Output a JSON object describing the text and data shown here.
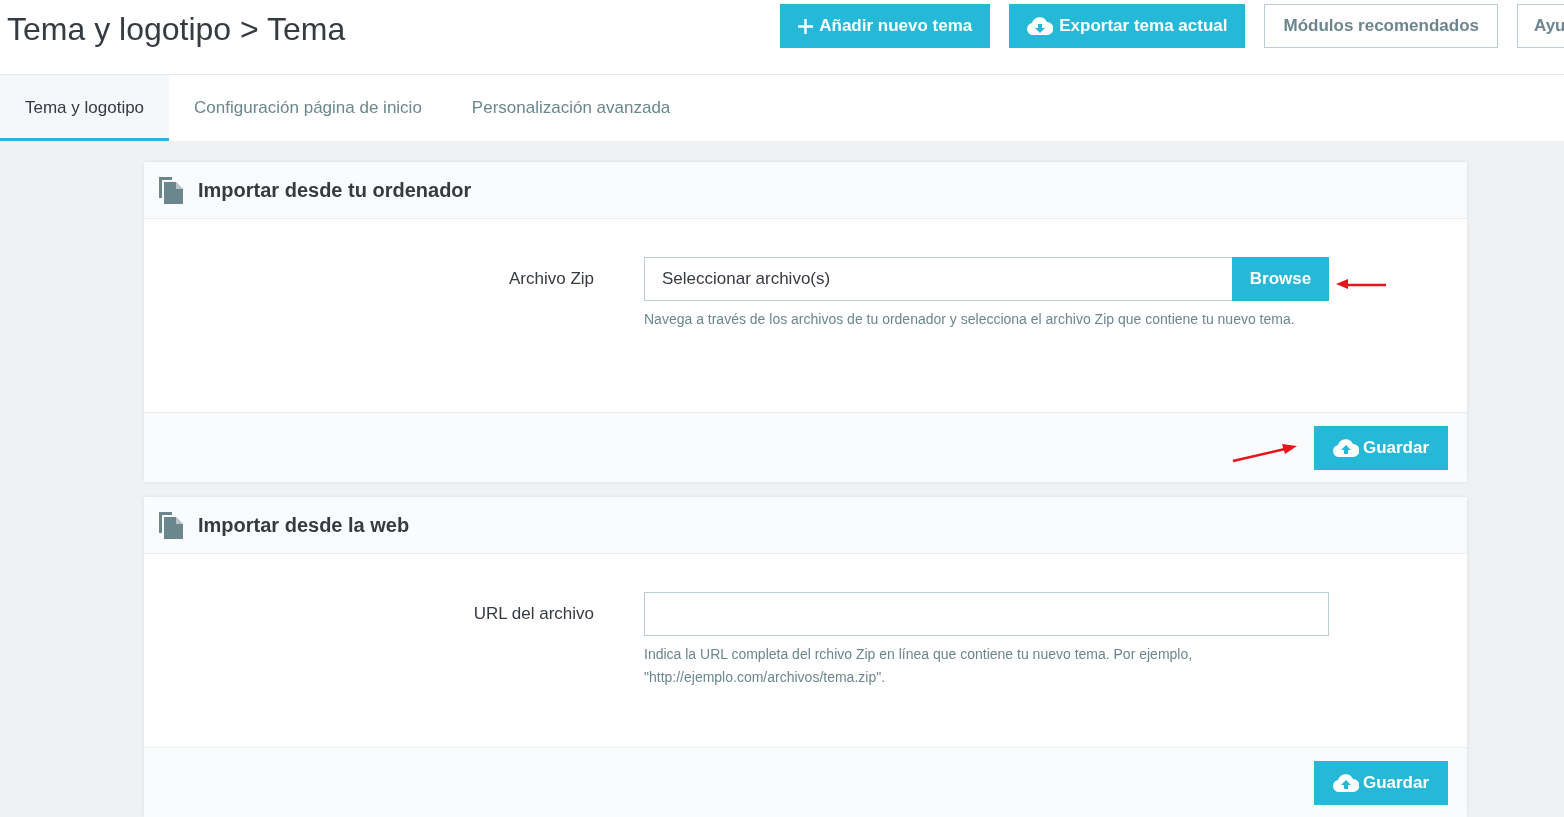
{
  "header": {
    "title": "Tema y logotipo > Tema"
  },
  "toolbar_buttons": [
    {
      "label": "Añadir nuevo tema",
      "kind": "add"
    },
    {
      "label": "Exportar tema actual",
      "kind": "export"
    },
    {
      "label": "Módulos recomendados",
      "kind": "outline"
    },
    {
      "label": "Ayu",
      "kind": "outline"
    }
  ],
  "tabs": [
    {
      "label": "Tema y logotipo",
      "selected": true
    },
    {
      "label": "Configuración página de inicio",
      "selected": false
    },
    {
      "label": "Personalización avanzada",
      "selected": false
    }
  ],
  "panels": [
    {
      "title": "Importar desde tu ordenador",
      "field": {
        "kind": "file",
        "label": "Archivo Zip",
        "value": "Seleccionar archivo(s)",
        "button": "Browse"
      },
      "help": "Navega a través de los archivos de tu ordenador y selecciona el archivo Zip que contiene tu nuevo tema.",
      "save_button": "Guardar"
    },
    {
      "title": "Importar desde la web",
      "field": {
        "kind": "url",
        "label": "URL del archivo"
      },
      "help": "Indica la URL completa del rchivo Zip en línea que contiene tu nuevo tema. Por ejemplo, \"http://ejemplo.com/archivos/tema.zip\".",
      "save_button": "Guardar"
    }
  ]
}
